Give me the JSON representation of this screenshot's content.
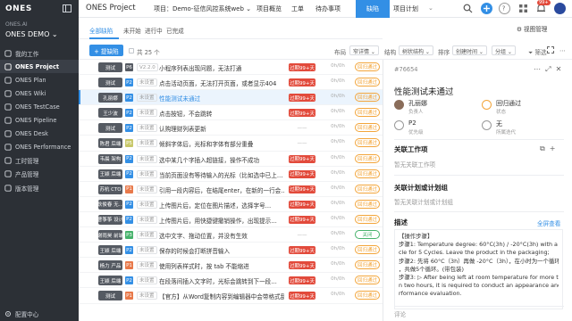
{
  "brand": "ONES",
  "org": "ONES.AI",
  "team": "ONES DEMO",
  "sidebar": {
    "items": [
      {
        "label": "我的工作",
        "icon": "home-icon"
      },
      {
        "label": "ONES Project",
        "icon": "project-icon",
        "active": true
      },
      {
        "label": "ONES Plan",
        "icon": "plan-icon"
      },
      {
        "label": "ONES Wiki",
        "icon": "wiki-icon"
      },
      {
        "label": "ONES TestCase",
        "icon": "testcase-icon"
      },
      {
        "label": "ONES Pipeline",
        "icon": "pipeline-icon"
      },
      {
        "label": "ONES Desk",
        "icon": "desk-icon"
      },
      {
        "label": "ONES Performance",
        "icon": "performance-icon"
      },
      {
        "label": "工时管理",
        "icon": "time-icon"
      },
      {
        "label": "产品管理",
        "icon": "product-icon"
      },
      {
        "label": "版本管理",
        "icon": "version-icon"
      }
    ],
    "config": "配置中心"
  },
  "topbar": {
    "title": "ONES Project",
    "project": "项目：Demo-征信风控系统web",
    "tabs": [
      "项目概览",
      "工单",
      "待办事项",
      "项目计划"
    ],
    "active_tab": "缺陷",
    "badge": "99+"
  },
  "subtabs": {
    "items": [
      "全部缺陷",
      "未开始",
      "进行中",
      "已完成"
    ],
    "view_settings": "视图管理"
  },
  "toolbar": {
    "create": "+ 提缺陷",
    "count": "共 25 个",
    "layout_label": "布局",
    "layout_value": "窄详情",
    "group_label": "结构",
    "group_value": "树状结构",
    "sort_label": "排序",
    "sort_value": "创建时间",
    "group": "分组",
    "filter": "筛选"
  },
  "rows": [
    {
      "assignee": "测试",
      "pri": "P6",
      "pri_color": "#555a62",
      "ver": "V2.2.0",
      "title": "小程序列表出现问题，无法打通",
      "dl": "过期99+天",
      "dl_type": "over",
      "hr": "0h/0h",
      "st": "回归通过"
    },
    {
      "assignee": "测试",
      "pri": "P2",
      "pri_color": "#338fe5",
      "ver": "未设置",
      "title": "点击活动页面，无法打开页面，或者显示404",
      "dl": "过期99+天",
      "dl_type": "over",
      "hr": "0h/0h",
      "st": "回归通过"
    },
    {
      "assignee": "孔丽娜",
      "pri": "P2",
      "pri_color": "#338fe5",
      "ver": "未设置",
      "title": "性能测试未通过",
      "dl": "过期99+天",
      "dl_type": "over",
      "hr": "0h/0h",
      "st": "回归通过",
      "selected": true
    },
    {
      "assignee": "王少波",
      "pri": "P2",
      "pri_color": "#338fe5",
      "ver": "未设置",
      "title": "点击按钮，不会跳转",
      "dl": "过期99+天",
      "dl_type": "over",
      "hr": "0h/0h",
      "st": "回归通过"
    },
    {
      "assignee": "测试",
      "pri": "P2",
      "pri_color": "#338fe5",
      "ver": "未设置",
      "title": "认购理财列表更新",
      "dl": "——",
      "dl_type": "gray",
      "hr": "0h/0h",
      "st": "回归通过"
    },
    {
      "assignee": "陈君 后端",
      "pri": "P5",
      "pri_color": "#c8c86a",
      "ver": "未设置",
      "title": "倾斜字体后，光标和字体有部分重叠",
      "dl": "——",
      "dl_type": "gray",
      "hr": "0h/0h",
      "st": "回归通过"
    },
    {
      "assignee": "韦晨 架构",
      "pri": "P2",
      "pri_color": "#338fe5",
      "ver": "未设置",
      "title": "选中某几个字插入超链接，操作不成功",
      "dl": "过期99+天",
      "dl_type": "over",
      "hr": "0h/0h",
      "st": "回归通过"
    },
    {
      "assignee": "王颖 后端",
      "pri": "P2",
      "pri_color": "#338fe5",
      "ver": "未设置",
      "title": "当前页面没有等待输入的光标（比如选中已上…",
      "dl": "过期99+天",
      "dl_type": "over",
      "hr": "0h/0h",
      "st": "回归通过"
    },
    {
      "assignee": "苏杭 CTO",
      "pri": "P1",
      "pri_color": "#e8794a",
      "ver": "未设置",
      "title": "引用一段内容后，在结尾enter，在新的一行会…",
      "dl": "过期99+天",
      "dl_type": "over",
      "hr": "0h/0h",
      "st": "回归通过"
    },
    {
      "assignee": "耿俊春 无…",
      "pri": "P2",
      "pri_color": "#338fe5",
      "ver": "未设置",
      "title": "上传图片后，定位在图片描述，选择字号…",
      "dl": "过期99+天",
      "dl_type": "over",
      "hr": "0h/0h",
      "st": "回归通过"
    },
    {
      "assignee": "曹筝筝 设计",
      "pri": "P2",
      "pri_color": "#338fe5",
      "ver": "未设置",
      "title": "上传图片后，用快捷键撤销操作，出现提示…",
      "dl": "过期99+天",
      "dl_type": "over",
      "hr": "0h/0h",
      "st": "回归通过"
    },
    {
      "assignee": "谢雨昊 前端",
      "pri": "P3",
      "pri_color": "#46b26b",
      "ver": "未设置",
      "title": "选中文字、拖动位置，并没有生效",
      "dl": "——",
      "dl_type": "gray",
      "hr": "0h/0h",
      "st": "关闭",
      "st_type": "green"
    },
    {
      "assignee": "王颖 后端",
      "pri": "P2",
      "pri_color": "#338fe5",
      "ver": "未设置",
      "title": "保存的时候会打断拼音输入",
      "dl": "过期99+天",
      "dl_type": "over",
      "hr": "0h/0h",
      "st": "回归通过"
    },
    {
      "assignee": "杨力 产品",
      "pri": "P1",
      "pri_color": "#e8794a",
      "ver": "未设置",
      "title": "使用列表样式时，按 tab 不能缩进",
      "dl": "过期99+天",
      "dl_type": "over",
      "hr": "0h/0h",
      "st": "回归通过"
    },
    {
      "assignee": "王颖 后端",
      "pri": "P2",
      "pri_color": "#338fe5",
      "ver": "未设置",
      "title": "在段落间插入文字时，光标会跳转到下一段…",
      "dl": "过期99+天",
      "dl_type": "over",
      "hr": "0h/0h",
      "st": "回归通过"
    },
    {
      "assignee": "测试",
      "pri": "P1",
      "pri_color": "#e8794a",
      "ver": "未设置",
      "title": "【官方】从Word复制内容到编辑器中会带格式乱码",
      "dl": "过期99+天",
      "dl_type": "over",
      "hr": "0h/0h",
      "st": "回归通过"
    }
  ],
  "detail": {
    "id": "#76654",
    "title": "性能测试未通过",
    "assignee": "孔丽娜",
    "assignee_label": "负责人",
    "status": "回归通过",
    "status_label": "状态",
    "priority": "P2",
    "priority_label": "优先级",
    "iteration": "无",
    "iteration_label": "所属迭代",
    "linked_work": "关联工作项",
    "linked_work_empty": "暂无关联工作项",
    "linked_plan": "关联计划或计划组",
    "linked_plan_empty": "暂无关联计划或计划组",
    "desc": "描述",
    "desc_full": "全屏查看",
    "desc_lines": [
      "【操作步骤】",
      "步骤1: Temperature degree: 60°C(3h) / -20°C(3h) with a cy",
      "cle for 5 Cycles. Leave the product in the packaging;",
      "步骤2: 先将 60°C（3h）再做 -20°C（3h），在小时为一个循环",
      "，共做5个循环。(带包装)",
      "步骤3: ▷ After being left at room temperature for more tha",
      "n two hours, it is required to conduct an appearance and pe",
      "rformance evaluation."
    ],
    "comment_placeholder": "评论"
  }
}
